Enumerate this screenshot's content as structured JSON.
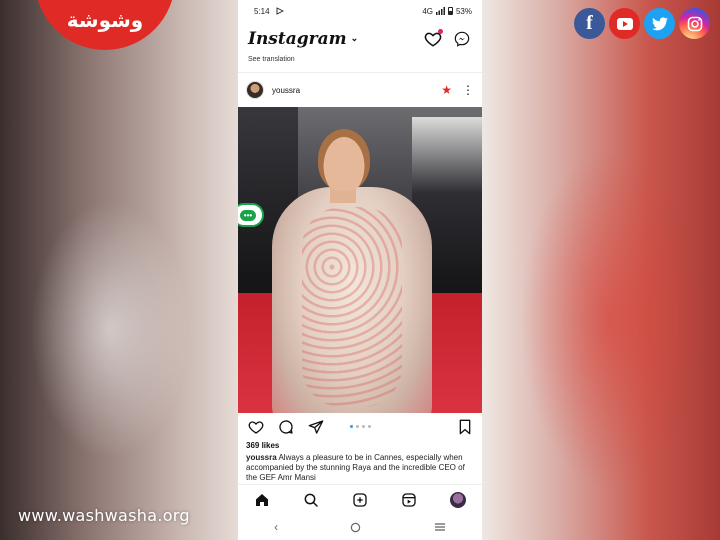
{
  "branding": {
    "site_logo_text": "وشوشة",
    "watermark_url": "www.washwasha.org",
    "social": [
      {
        "name": "facebook-icon",
        "glyph": "f",
        "color": "#3b5998"
      },
      {
        "name": "youtube-icon",
        "glyph": "▶",
        "color": "#e02a25"
      },
      {
        "name": "twitter-icon",
        "glyph": "🐦",
        "color": "#1da1f2"
      },
      {
        "name": "instagram-icon",
        "glyph": "◎",
        "color": "#d6249f"
      }
    ]
  },
  "status_bar": {
    "time": "5:14",
    "network": "4G",
    "battery": "53%"
  },
  "app": {
    "title": "Instagram",
    "chevron": "⌄",
    "see_translation": "See translation"
  },
  "post": {
    "username": "youssra",
    "likes": "369 likes",
    "caption_user": "youssra",
    "caption_text": " Always a pleasure to be in Cannes, especially when accompanied by the stunning Raya and the incredible CEO of the GEF Amr Mansi",
    "carousel": {
      "count": 4,
      "active_index": 0
    },
    "overlay_button": "•••"
  },
  "colors": {
    "accent_red": "#e02a25",
    "ig_blue": "#3897f0",
    "green": "#1aa34a"
  }
}
